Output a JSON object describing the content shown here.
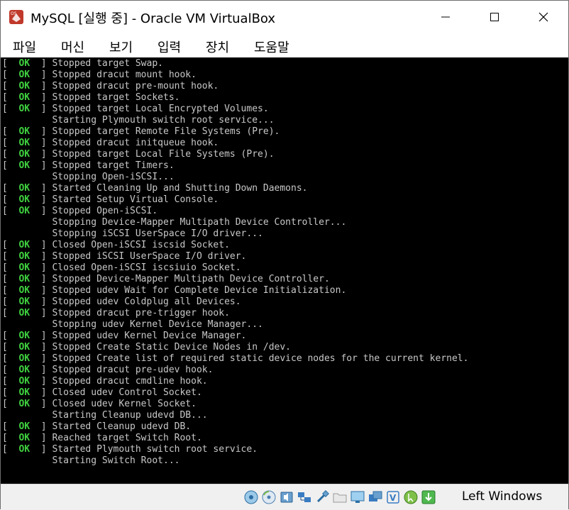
{
  "window": {
    "title": "MySQL [실행 중] - Oracle VM VirtualBox"
  },
  "menu": {
    "items": [
      "파일",
      "머신",
      "보기",
      "입력",
      "장치",
      "도움말"
    ]
  },
  "console": {
    "lines": [
      {
        "ok": true,
        "text": "Stopped target Swap."
      },
      {
        "ok": true,
        "text": "Stopped dracut mount hook."
      },
      {
        "ok": true,
        "text": "Stopped dracut pre-mount hook."
      },
      {
        "ok": true,
        "text": "Stopped target Sockets."
      },
      {
        "ok": true,
        "text": "Stopped target Local Encrypted Volumes."
      },
      {
        "ok": false,
        "text": "Starting Plymouth switch root service..."
      },
      {
        "ok": true,
        "text": "Stopped target Remote File Systems (Pre)."
      },
      {
        "ok": true,
        "text": "Stopped dracut initqueue hook."
      },
      {
        "ok": true,
        "text": "Stopped target Local File Systems (Pre)."
      },
      {
        "ok": true,
        "text": "Stopped target Timers."
      },
      {
        "ok": false,
        "text": "Stopping Open-iSCSI..."
      },
      {
        "ok": true,
        "text": "Started Cleaning Up and Shutting Down Daemons."
      },
      {
        "ok": true,
        "text": "Started Setup Virtual Console."
      },
      {
        "ok": true,
        "text": "Stopped Open-iSCSI."
      },
      {
        "ok": false,
        "text": "Stopping Device-Mapper Multipath Device Controller..."
      },
      {
        "ok": false,
        "text": "Stopping iSCSI UserSpace I/O driver..."
      },
      {
        "ok": true,
        "text": "Closed Open-iSCSI iscsid Socket."
      },
      {
        "ok": true,
        "text": "Stopped iSCSI UserSpace I/O driver."
      },
      {
        "ok": true,
        "text": "Closed Open-iSCSI iscsiuio Socket."
      },
      {
        "ok": true,
        "text": "Stopped Device-Mapper Multipath Device Controller."
      },
      {
        "ok": true,
        "text": "Stopped udev Wait for Complete Device Initialization."
      },
      {
        "ok": true,
        "text": "Stopped udev Coldplug all Devices."
      },
      {
        "ok": true,
        "text": "Stopped dracut pre-trigger hook."
      },
      {
        "ok": false,
        "text": "Stopping udev Kernel Device Manager..."
      },
      {
        "ok": true,
        "text": "Stopped udev Kernel Device Manager."
      },
      {
        "ok": true,
        "text": "Stopped Create Static Device Nodes in /dev."
      },
      {
        "ok": true,
        "text": "Stopped Create list of required static device nodes for the current kernel."
      },
      {
        "ok": true,
        "text": "Stopped dracut pre-udev hook."
      },
      {
        "ok": true,
        "text": "Stopped dracut cmdline hook."
      },
      {
        "ok": true,
        "text": "Closed udev Control Socket."
      },
      {
        "ok": true,
        "text": "Closed udev Kernel Socket."
      },
      {
        "ok": false,
        "text": "Starting Cleanup udevd DB..."
      },
      {
        "ok": true,
        "text": "Started Cleanup udevd DB."
      },
      {
        "ok": true,
        "text": "Reached target Switch Root."
      },
      {
        "ok": true,
        "text": "Started Plymouth switch root service."
      },
      {
        "ok": false,
        "text": "Starting Switch Root..."
      }
    ],
    "ok_label": "OK",
    "ok_color": "#3fd13f",
    "background": "#000000"
  },
  "statusbar": {
    "icons": [
      "hard-disk-icon",
      "optical-drive-icon",
      "audio-icon",
      "network-icon",
      "usb-icon",
      "shared-folders-icon",
      "display-icon",
      "recording-icon",
      "cpu-virtualization-icon",
      "mouse-integration-icon",
      "keyboard-capture-icon"
    ],
    "host_key": "Left Windows"
  }
}
